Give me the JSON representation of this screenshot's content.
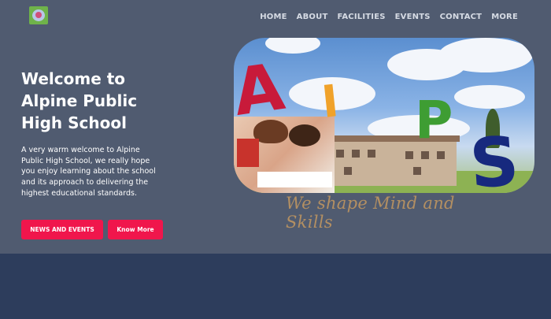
{
  "nav": {
    "items": [
      "HOME",
      "ABOUT",
      "FACILITIES",
      "EVENTS",
      "CONTACT",
      "MORE"
    ]
  },
  "hero": {
    "title_lines": [
      "Welcome to",
      "Alpine Public",
      "High School"
    ],
    "intro": "A very warm welcome to Alpine Public High School, we really hope you enjoy learning about the school and its approach to delivering the highest educational standards.",
    "buttons": {
      "news": "NEWS AND EVENTS",
      "know": "Know More"
    }
  },
  "banner": {
    "letters": [
      "A",
      "I",
      "P",
      "S"
    ],
    "tagline": "We shape Mind and Skills"
  },
  "colors": {
    "hero_bg": "#505b70",
    "footer_bg": "#2d3d5c",
    "button": "#f0164c",
    "nav_text": "#d6dbe4"
  },
  "icons": {
    "logo": "school-logo-icon"
  }
}
